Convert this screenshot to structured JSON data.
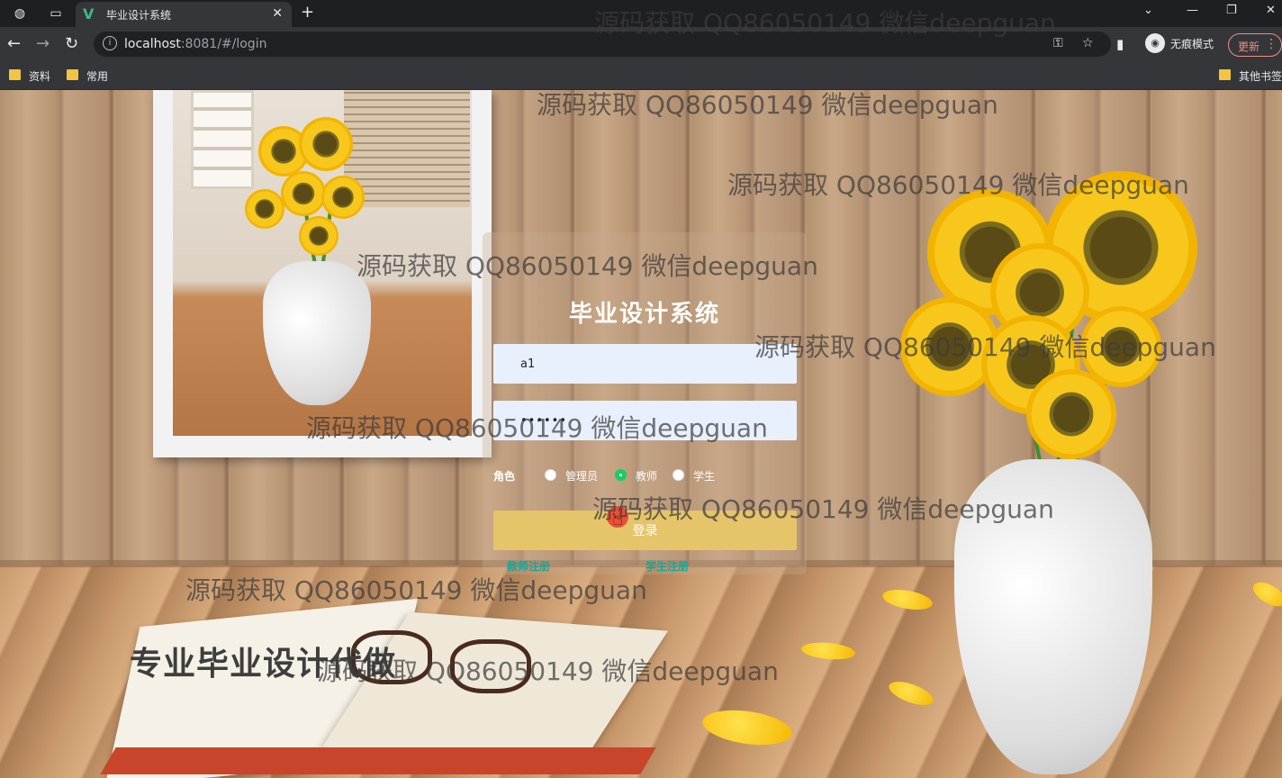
{
  "browser": {
    "tab_title": "毕业设计系统",
    "url_host": "localhost",
    "url_rest": ":8081/#/login",
    "incognito_label": "无痕模式",
    "update_label": "更新",
    "bookmarks": [
      "资料",
      "常用"
    ],
    "other_bookmarks": "其他书签"
  },
  "login": {
    "title": "毕业设计系统",
    "username_value": "a1",
    "password_value": "••••••",
    "role_label": "角色",
    "roles": [
      {
        "label": "管理员",
        "selected": false
      },
      {
        "label": "教师",
        "selected": true
      },
      {
        "label": "学生",
        "selected": false
      }
    ],
    "login_button": "登录",
    "teacher_register": "教师注册",
    "student_register": "学生注册"
  },
  "slogan": "专业毕业设计代做",
  "watermark": "源码获取 QQ86050149 微信deepguan",
  "colors": {
    "accent_green": "#13ce66",
    "link_teal": "#13a89e",
    "button_gold": "#e6c46a",
    "field_bg": "#e8f0fe"
  },
  "icons": [
    "globe-icon",
    "window-icon",
    "vue-logo-icon",
    "close-icon",
    "plus-icon",
    "back-icon",
    "forward-icon",
    "reload-icon",
    "info-icon",
    "key-icon",
    "star-icon",
    "sidebar-icon",
    "incognito-icon",
    "more-icon",
    "folder-icon"
  ]
}
